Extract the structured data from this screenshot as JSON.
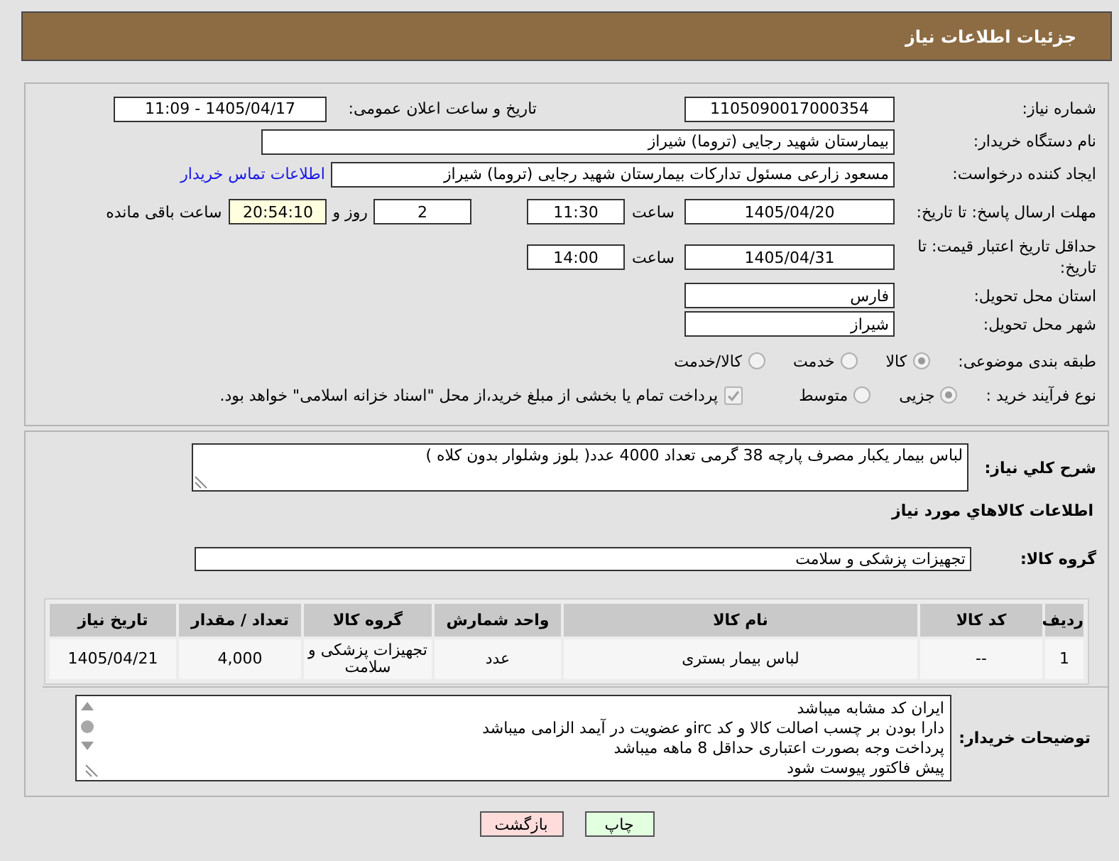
{
  "header": {
    "title": "جزئیات اطلاعات نیاز"
  },
  "form": {
    "need_number": {
      "label": "شماره نیاز:",
      "value": "1105090017000354"
    },
    "announce": {
      "label": "تاریخ و ساعت اعلان عمومی:",
      "value": "1405/04/17 - 11:09"
    },
    "buyer": {
      "label": "نام دستگاه خریدار:",
      "value": "بیمارستان شهید رجایی (تروما) شیراز"
    },
    "requester": {
      "label": "ایجاد کننده درخواست:",
      "value": "مسعود زارعی مسئول تدارکات بیمارستان شهید رجایی (تروما) شیراز",
      "link": "اطلاعات تماس خریدار"
    },
    "deadline": {
      "label": "مهلت ارسال پاسخ: تا تاریخ:",
      "date": "1405/04/20",
      "time_label": "ساعت",
      "time": "11:30",
      "days": "2",
      "days_label": "روز و",
      "remaining": "20:54:10",
      "remaining_label": "ساعت باقی مانده"
    },
    "validity": {
      "label": "حداقل تاریخ اعتبار قیمت: تا تاریخ:",
      "date": "1405/04/31",
      "time_label": "ساعت",
      "time": "14:00"
    },
    "province": {
      "label": "استان محل تحویل:",
      "value": "فارس"
    },
    "city": {
      "label": "شهر محل تحویل:",
      "value": "شیراز"
    },
    "category": {
      "label": "طبقه بندی موضوعی:",
      "options": [
        {
          "label": "کالا",
          "selected": true
        },
        {
          "label": "خدمت",
          "selected": false
        },
        {
          "label": "کالا/خدمت",
          "selected": false
        }
      ]
    },
    "process": {
      "label": "نوع فرآیند خرید :",
      "options": [
        {
          "label": "جزیی",
          "selected": true
        },
        {
          "label": "متوسط",
          "selected": false
        }
      ],
      "treasury": {
        "label": "پرداخت تمام یا بخشی از مبلغ خرید،از محل \"اسناد خزانه اسلامی\" خواهد بود.",
        "checked": true
      }
    }
  },
  "summary": {
    "label": "شرح کلي نیاز:",
    "value": "لباس بیمار یکبار مصرف پارچه 38 گرمی تعداد 4000 عدد( بلوز وشلوار بدون کلاه )"
  },
  "goods": {
    "heading": "اطلاعات کالاهاي مورد نیاز",
    "group_label": "گروه کالا:",
    "group": "تجهیزات پزشکی و سلامت"
  },
  "table": {
    "columns": [
      "ردیف",
      "کد کالا",
      "نام کالا",
      "واحد شمارش",
      "گروه کالا",
      "تعداد / مقدار",
      "تاریخ نیاز"
    ],
    "rows": [
      [
        "1",
        "--",
        "لباس بیمار بستری",
        "عدد",
        "تجهیزات پزشکی و سلامت",
        "4,000",
        "1405/04/21"
      ]
    ]
  },
  "notes": {
    "label": "توضیحات خریدار:",
    "lines": [
      "ایران کد مشابه میباشد",
      "دارا بودن بر چسب اصالت کالا و کد ircو عضویت در آیمد الزامی میباشد",
      "پرداخت وجه بصورت اعتباری حداقل 8 ماهه میباشد",
      "پیش فاکتور پیوست شود"
    ]
  },
  "buttons": [
    {
      "label": "چاپ",
      "kind": "print"
    },
    {
      "label": "بازگشت",
      "kind": "back"
    }
  ]
}
